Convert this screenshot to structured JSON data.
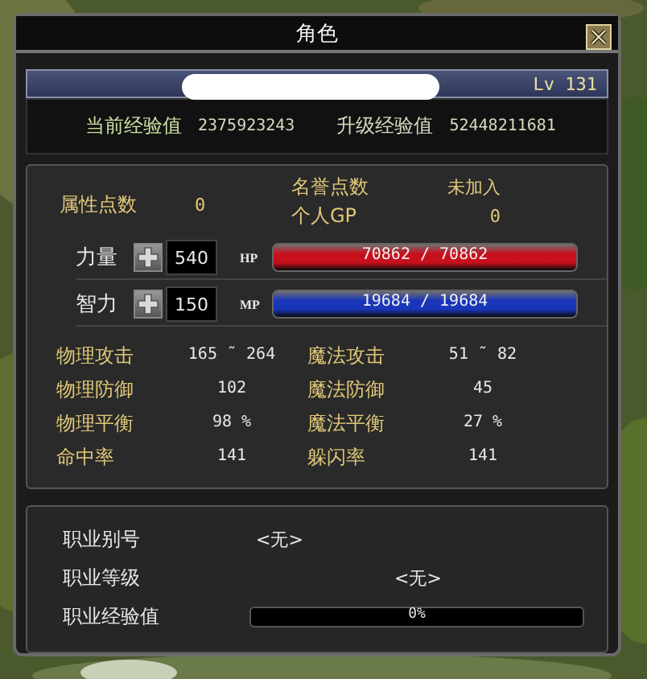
{
  "window": {
    "title": "角色"
  },
  "name_bar": {
    "level_text": "Lv 131"
  },
  "experience": [
    {
      "label": "当前经验值",
      "value": "2375923243"
    },
    {
      "label": "升级经验值",
      "value": "52448211681"
    }
  ],
  "points": {
    "attribute": {
      "label": "属性点数",
      "value": "0"
    },
    "fame": {
      "label": "名誉点数",
      "value": "未加入"
    },
    "personal_gp": {
      "label": "个人GP",
      "value": "0"
    }
  },
  "attributes": [
    {
      "label": "力量",
      "value": "540",
      "bar_label": "HP",
      "reading": "70862 / 70862",
      "level": 1,
      "color": "#c8101c"
    },
    {
      "label": "智力",
      "value": "150",
      "bar_label": "MP",
      "reading": "19684 / 19684",
      "level": 1,
      "color": "#1a36b8"
    }
  ],
  "stats": [
    {
      "label": "物理攻击",
      "value": "165 ˜ 264"
    },
    {
      "label": "魔法攻击",
      "value": "51 ˜ 82"
    },
    {
      "label": "物理防御",
      "value": "102"
    },
    {
      "label": "魔法防御",
      "value": "45"
    },
    {
      "label": "物理平衡",
      "value": "98 %"
    },
    {
      "label": "魔法平衡",
      "value": "27 %"
    },
    {
      "label": "命中率",
      "value": "141"
    },
    {
      "label": "躲闪率",
      "value": "141"
    }
  ],
  "job": [
    {
      "label": "职业别号",
      "value": "<无>",
      "kind": "near"
    },
    {
      "label": "职业等级",
      "value": "<无>",
      "kind": "far"
    }
  ],
  "job_exp": {
    "label": "职业经验值",
    "reading": "0%",
    "level": 0
  }
}
